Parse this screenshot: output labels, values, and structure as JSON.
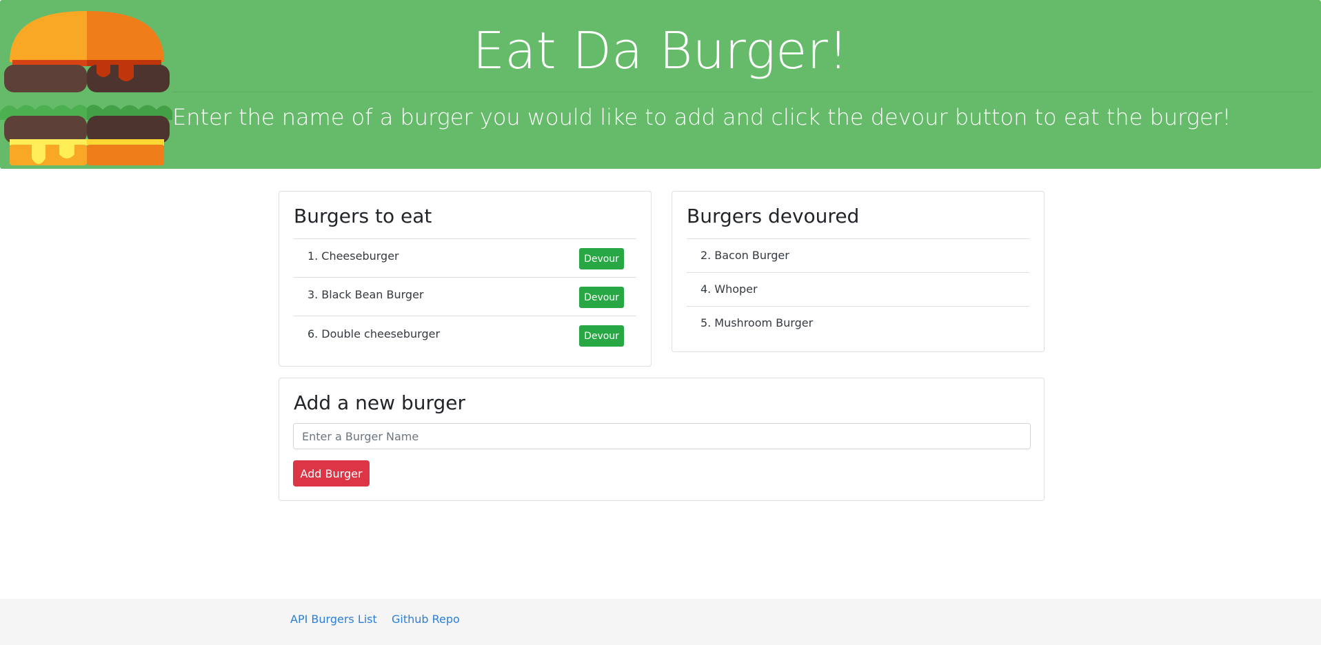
{
  "header": {
    "title": "Eat Da Burger!",
    "lead": "Enter the name of a burger you would like to add and click the devour button to eat the burger!",
    "background_color": "#66bb6a",
    "logo_icon": "burger-icon"
  },
  "to_eat": {
    "title": "Burgers to eat",
    "devour_label": "Devour",
    "items": [
      {
        "num": "1.",
        "name": "Cheeseburger",
        "button": "Devour"
      },
      {
        "num": "3.",
        "name": "Black Bean Burger",
        "button": "Devour"
      },
      {
        "num": "6.",
        "name": "Double cheeseburger",
        "button": "Devour"
      }
    ]
  },
  "devoured": {
    "title": "Burgers devoured",
    "items": [
      {
        "num": "2.",
        "name": "Bacon Burger"
      },
      {
        "num": "4.",
        "name": "Whoper"
      },
      {
        "num": "5.",
        "name": "Mushroom Burger"
      }
    ]
  },
  "add_form": {
    "title": "Add a new burger",
    "input_value": "",
    "input_placeholder": "Enter a Burger Name",
    "button_label": "Add Burger"
  },
  "footer": {
    "links": [
      {
        "label": "API Burgers List"
      },
      {
        "label": "Github Repo"
      }
    ]
  },
  "colors": {
    "devour_button": "#28a745",
    "add_button": "#dc3545",
    "link": "#2b7fd8",
    "footer_bg": "#f5f5f5"
  }
}
